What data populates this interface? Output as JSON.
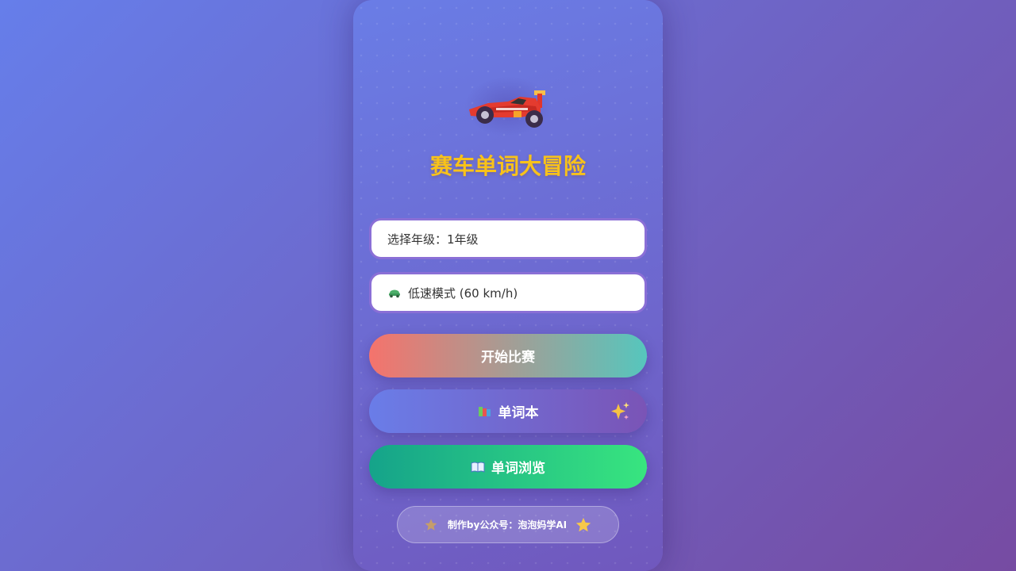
{
  "app": {
    "title": "赛车单词大冒险"
  },
  "hero": {
    "icon": "race-car-icon"
  },
  "form": {
    "grade_select": "选择年级：1年级",
    "speed_select": "低速模式 (60 km/h)",
    "speed_icon": "green-car-icon"
  },
  "buttons": {
    "start": "开始比赛",
    "wordbook": "单词本",
    "wordbook_icon": "books-icon",
    "wordbook_badge_icon": "sparkles-icon",
    "browse": "单词浏览",
    "browse_icon": "open-book-icon"
  },
  "footer": {
    "text": "制作by公众号：泡泡妈学AI",
    "left_icon": "star-icon",
    "right_icon": "star-icon"
  },
  "colors": {
    "title": "#f8c21a",
    "start_gradient": [
      "#f5736c",
      "#56c6bd"
    ],
    "wordbook_gradient": [
      "#6a7de8",
      "#7a54b6"
    ],
    "browse_gradient": [
      "#15a38a",
      "#38e57f"
    ],
    "background_gradient": [
      "#667eea",
      "#764ba2"
    ]
  }
}
